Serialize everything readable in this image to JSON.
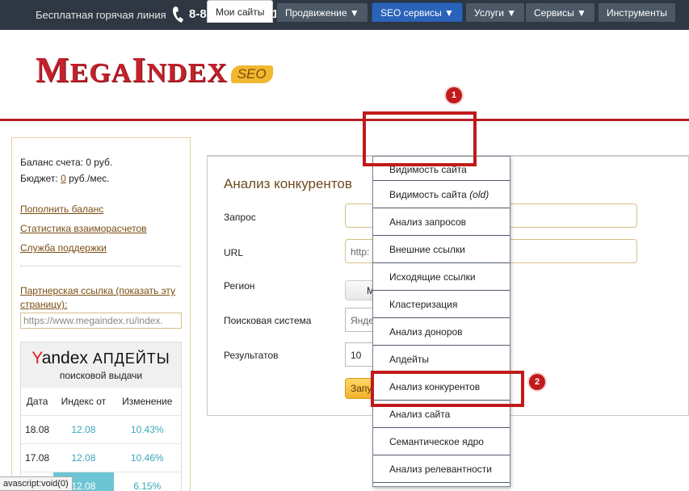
{
  "topbar": {
    "hotline_label": "Бесплатная горячая линия",
    "phone_number": "8-800-555-11-91"
  },
  "logo": {
    "text_m": "M",
    "text_ega": "EGA",
    "text_i": "I",
    "text_ndex": "NDEX",
    "badge": "SEO"
  },
  "sidebar": {
    "balance": "Баланс счета: 0 руб.",
    "budget_prefix": "Бюджет: ",
    "budget_value": "0",
    "budget_suffix": " руб./мес.",
    "links": [
      "Пополнить баланс",
      "Статистика взаиморасчетов",
      "Служба поддержки"
    ],
    "partner_link": "Партнерская ссылка (показать эту страницу):",
    "partner_input": "https://www.megaindex.ru/index."
  },
  "yandex": {
    "brand_y": "Y",
    "brand_rest": "andex",
    "brand_upd": " АПДЕЙТЫ",
    "subtitle": "поисковой выдачи",
    "columns": [
      "Дата",
      "Индекс от",
      "Изменение"
    ],
    "rows": [
      {
        "date": "18.08",
        "index": "12.08",
        "change": "10.43%"
      },
      {
        "date": "17.08",
        "index": "12.08",
        "change": "10.46%"
      },
      {
        "date": "",
        "index": "12.08",
        "change": "6.15%"
      }
    ]
  },
  "statusbar": "avascript:void(0)",
  "tabs": [
    {
      "label": "Мои сайты"
    },
    {
      "label": "Продвижение ▼"
    },
    {
      "label": "SEO сервисы ▼"
    },
    {
      "label": "Услуги ▼"
    },
    {
      "label": "Сервисы ▼"
    },
    {
      "label": "Инструменты"
    }
  ],
  "form": {
    "title": "Анализ конкурентов",
    "labels": [
      "Запрос",
      "URL",
      "Регион",
      "Поисковая система",
      "Результатов"
    ],
    "url_placeholder": "http:",
    "region_btn": "М",
    "engine_value": "Янде",
    "results_value": "10",
    "submit": "Запу"
  },
  "dropdown": {
    "items": [
      "Видимость сайта",
      "Видимость сайта",
      "Анализ запросов",
      "Внешние ссылки",
      "Исходящие ссылки",
      "Кластеризация",
      "Анализ доноров",
      "Апдейты",
      "Анализ конкурентов",
      "Анализ сайта",
      "Семантическое ядро",
      "Анализ релевантности"
    ],
    "item2_suffix": "(old)"
  },
  "annotations": [
    "1",
    "2"
  ],
  "colors": {
    "topbar": "#2f3742",
    "brand_red": "#c3212b",
    "seo_tab": "#2a63b8",
    "annotation": "#c11a1a",
    "accent_gold": "#f1b22a"
  }
}
